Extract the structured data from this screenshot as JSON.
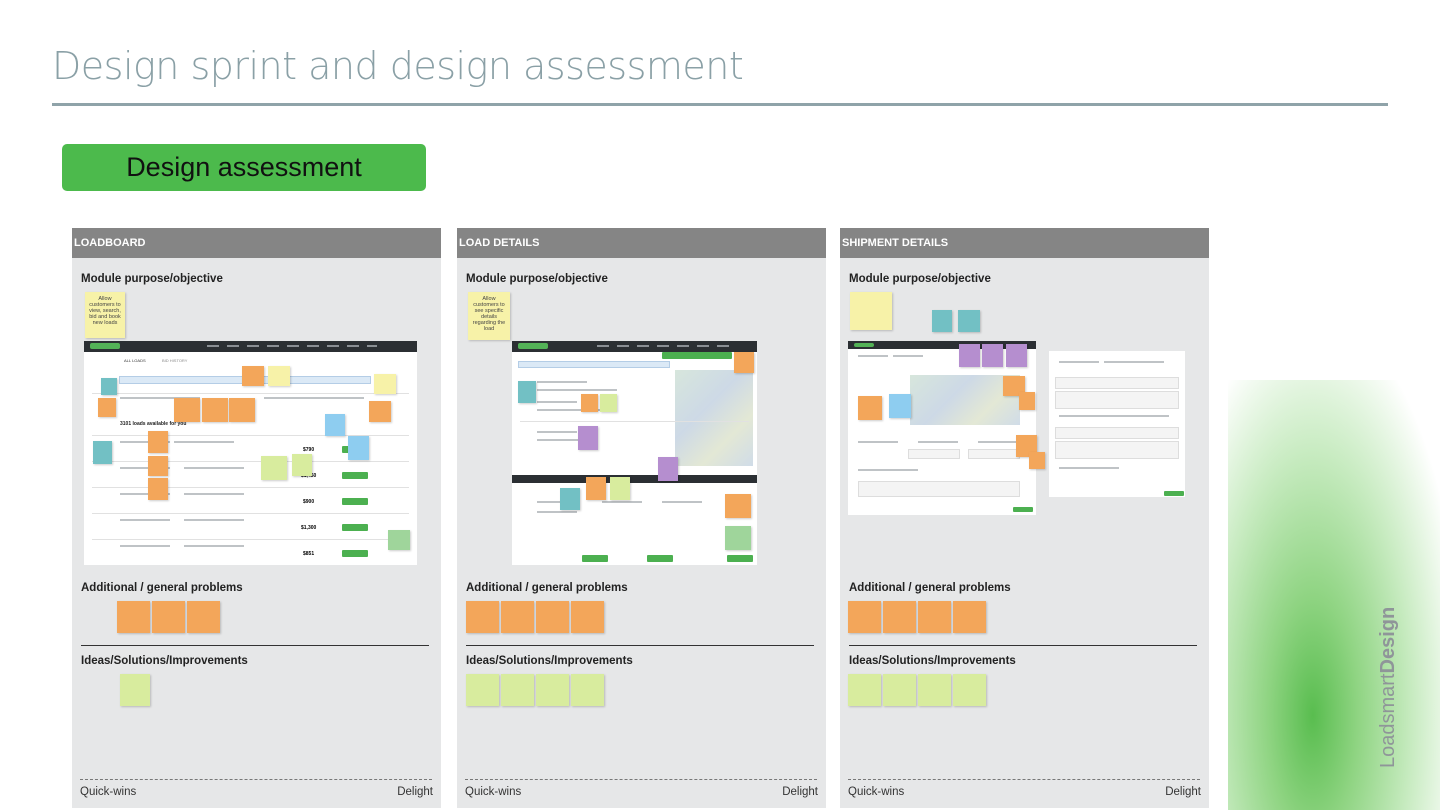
{
  "page": {
    "title": "Design sprint and design assessment",
    "pill": "Design assessment",
    "brand_light": "Loadsmart",
    "brand_bold": "Design"
  },
  "boards": [
    {
      "header": "LOADBOARD",
      "purpose": "Module purpose/objective",
      "purpose_note": "Allow customers to view, search, bid and book new loads",
      "problems": "Additional / general problems",
      "ideas": "Ideas/Solutions/Improvements",
      "quick": "Quick-wins",
      "delight": "Delight"
    },
    {
      "header": "LOAD DETAILS",
      "purpose": "Module purpose/objective",
      "purpose_note": "Allow customers to see specific details regarding the load",
      "problems": "Additional / general problems",
      "ideas": "Ideas/Solutions/Improvements",
      "quick": "Quick-wins",
      "delight": "Delight"
    },
    {
      "header": "SHIPMENT DETAILS",
      "purpose": "Module purpose/objective",
      "purpose_note": "",
      "problems": "Additional / general problems",
      "ideas": "Ideas/Solutions/Improvements",
      "quick": "Quick-wins",
      "delight": "Delight"
    }
  ],
  "loadboard_shot": {
    "tab_all": "ALL LOADS",
    "tab_history": "BID HISTORY",
    "results": "3101 loads available for you",
    "prices": [
      "$790",
      "$1,450",
      "$900",
      "$1,300",
      "$851"
    ]
  },
  "colors": {
    "yellow": "#f7f2a8",
    "orange": "#f3a65a",
    "light_green": "#d8ec9e",
    "teal": "#72c0c4",
    "blue": "#8ecdf0",
    "purple": "#b58ecf",
    "accent_green": "#4cba4c"
  }
}
